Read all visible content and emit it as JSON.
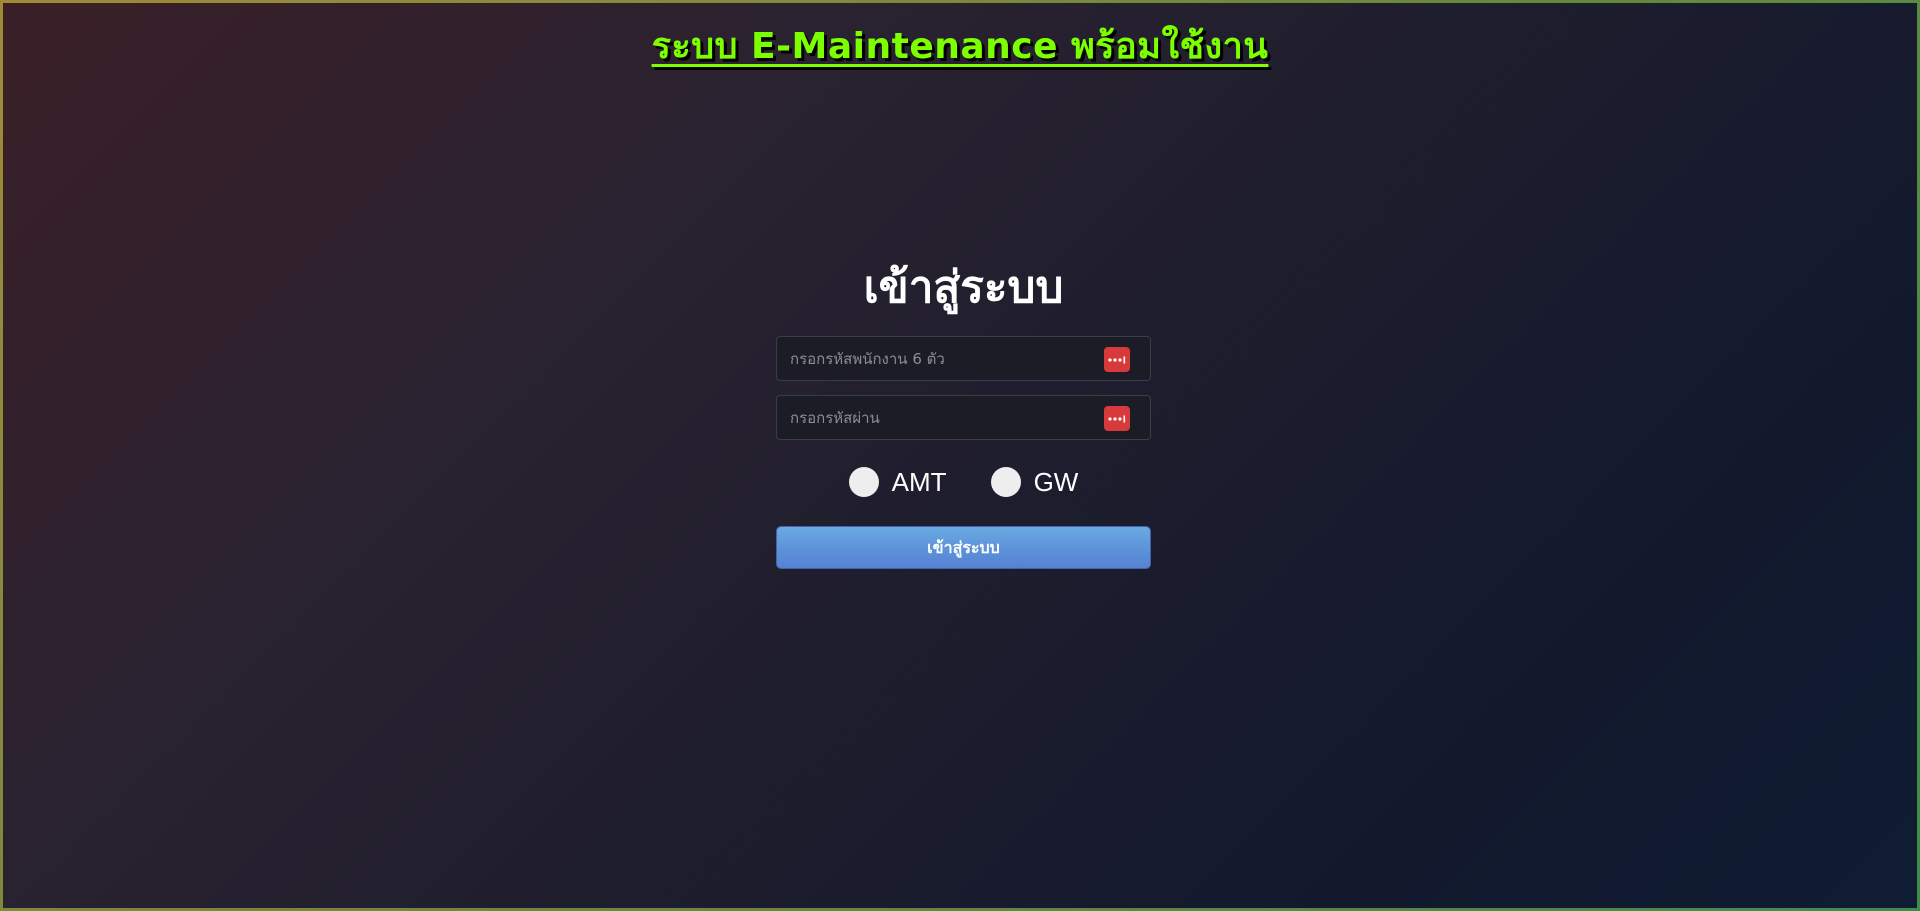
{
  "banner": {
    "text": "ระบบ E-Maintenance พร้อมใช้งาน"
  },
  "login": {
    "title": "เข้าสู่ระบบ",
    "employee_field": {
      "placeholder": "กรอกรหัสพนักงาน 6 ตัว",
      "value": "",
      "icon": "password-manager-icon"
    },
    "password_field": {
      "placeholder": "กรอกรหัสผ่าน",
      "value": "",
      "icon": "password-manager-icon"
    },
    "site_options": [
      {
        "label": "AMT",
        "selected": false
      },
      {
        "label": "GW",
        "selected": false
      }
    ],
    "submit_label": "เข้าสู่ระบบ"
  },
  "colors": {
    "banner": "#7cff00",
    "submit_button": "#5d92da",
    "pw_icon": "#d63a3a"
  }
}
